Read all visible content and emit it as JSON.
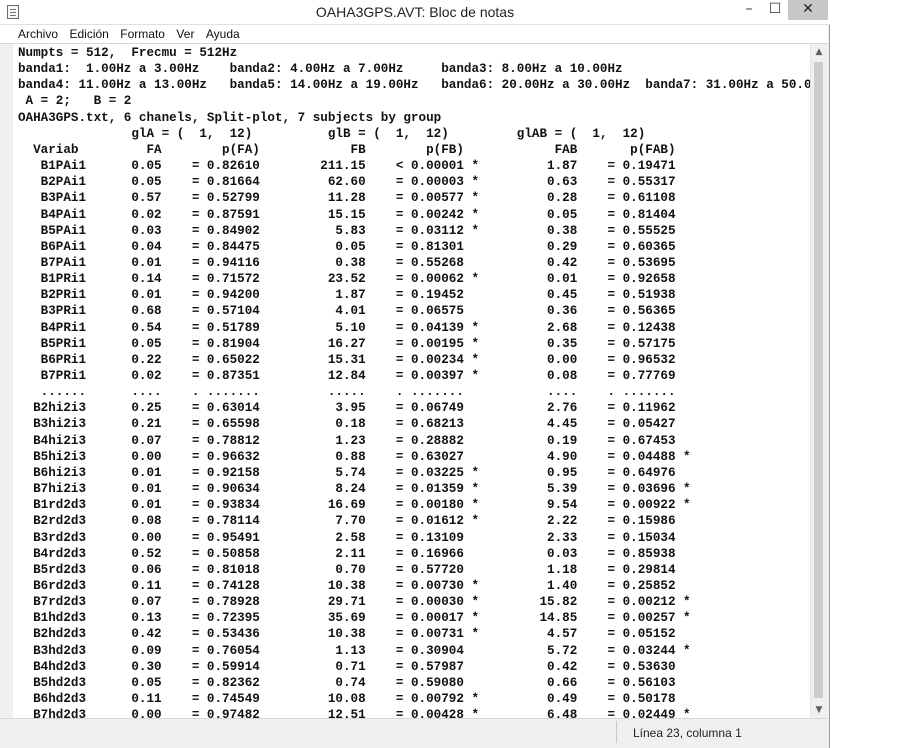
{
  "window": {
    "title": "OAHA3GPS.AVT: Bloc de notas",
    "minimize_glyph": "–",
    "maximize_glyph": "☐",
    "close_glyph": "✕"
  },
  "menu": [
    "Archivo",
    "Edición",
    "Formato",
    "Ver",
    "Ayuda"
  ],
  "scrollbar": {
    "up_glyph": "▲",
    "down_glyph": "▼"
  },
  "status": {
    "position": "Línea 23, columna 1"
  },
  "text_lines": [
    "Numpts = 512,  Frecmu = 512Hz",
    "banda1:  1.00Hz a 3.00Hz    banda2: 4.00Hz a 7.00Hz     banda3: 8.00Hz a 10.00Hz",
    "banda4: 11.00Hz a 13.00Hz   banda5: 14.00Hz a 19.00Hz   banda6: 20.00Hz a 30.00Hz  banda7: 31.00Hz a 50.00Hz",
    " A = 2;   B = 2",
    "OAHA3GPS.txt, 6 chanels, Split-plot, 7 subjects by group",
    "               glA = (  1,  12)          glB = (  1,  12)         glAB = (  1,  12)",
    "  Variab         FA        p(FA)            FB        p(FB)            FAB       p(FAB)",
    "   B1PAi1      0.05    = 0.82610        211.15    < 0.00001 *         1.87    = 0.19471",
    "   B2PAi1      0.05    = 0.81664         62.60    = 0.00003 *         0.63    = 0.55317",
    "   B3PAi1      0.57    = 0.52799         11.28    = 0.00577 *         0.28    = 0.61108",
    "   B4PAi1      0.02    = 0.87591         15.15    = 0.00242 *         0.05    = 0.81404",
    "   B5PAi1      0.03    = 0.84902          5.83    = 0.03112 *         0.38    = 0.55525",
    "   B6PAi1      0.04    = 0.84475          0.05    = 0.81301           0.29    = 0.60365",
    "   B7PAi1      0.01    = 0.94116          0.38    = 0.55268           0.42    = 0.53695",
    "   B1PRi1      0.14    = 0.71572         23.52    = 0.00062 *         0.01    = 0.92658",
    "   B2PRi1      0.01    = 0.94200          1.87    = 0.19452           0.45    = 0.51938",
    "   B3PRi1      0.68    = 0.57104          4.01    = 0.06575           0.36    = 0.56365",
    "   B4PRi1      0.54    = 0.51789          5.10    = 0.04139 *         2.68    = 0.12438",
    "   B5PRi1      0.05    = 0.81904         16.27    = 0.00195 *         0.35    = 0.57175",
    "   B6PRi1      0.22    = 0.65022         15.31    = 0.00234 *         0.00    = 0.96532",
    "   B7PRi1      0.02    = 0.87351         12.84    = 0.00397 *         0.08    = 0.77769",
    "   ......      ....    . .......         .....    . .......           ....    . .......",
    "  B2hi2i3      0.25    = 0.63014          3.95    = 0.06749           2.76    = 0.11962",
    "  B3hi2i3      0.21    = 0.65598          0.18    = 0.68213           4.45    = 0.05427",
    "  B4hi2i3      0.07    = 0.78812          1.23    = 0.28882           0.19    = 0.67453",
    "  B5hi2i3      0.00    = 0.96632          0.88    = 0.63027           4.90    = 0.04488 *",
    "  B6hi2i3      0.01    = 0.92158          5.74    = 0.03225 *         0.95    = 0.64976",
    "  B7hi2i3      0.01    = 0.90634          8.24    = 0.01359 *         5.39    = 0.03696 *",
    "  B1rd2d3      0.01    = 0.93834         16.69    = 0.00180 *         9.54    = 0.00922 *",
    "  B2rd2d3      0.08    = 0.78114          7.70    = 0.01612 *         2.22    = 0.15986",
    "  B3rd2d3      0.00    = 0.95491          2.58    = 0.13109           2.33    = 0.15034",
    "  B4rd2d3      0.52    = 0.50858          2.11    = 0.16966           0.03    = 0.85938",
    "  B5rd2d3      0.06    = 0.81018          0.70    = 0.57720           1.18    = 0.29814",
    "  B6rd2d3      0.11    = 0.74128         10.38    = 0.00730 *         1.40    = 0.25852",
    "  B7rd2d3      0.07    = 0.78928         29.71    = 0.00030 *        15.82    = 0.00212 *",
    "  B1hd2d3      0.13    = 0.72395         35.69    = 0.00017 *        14.85    = 0.00257 *",
    "  B2hd2d3      0.42    = 0.53436         10.38    = 0.00731 *         4.57    = 0.05152",
    "  B3hd2d3      0.09    = 0.76054          1.13    = 0.30904           5.72    = 0.03244 *",
    "  B4hd2d3      0.30    = 0.59914          0.71    = 0.57987           0.42    = 0.53630",
    "  B5hd2d3      0.05    = 0.82362          0.74    = 0.59080           0.66    = 0.56103",
    "  B6hd2d3      0.11    = 0.74549         10.08    = 0.00792 *         0.49    = 0.50178",
    "  B7hd2d3      0.00    = 0.97482         12.51    = 0.00428 *         6.48    = 0.02449 *"
  ]
}
